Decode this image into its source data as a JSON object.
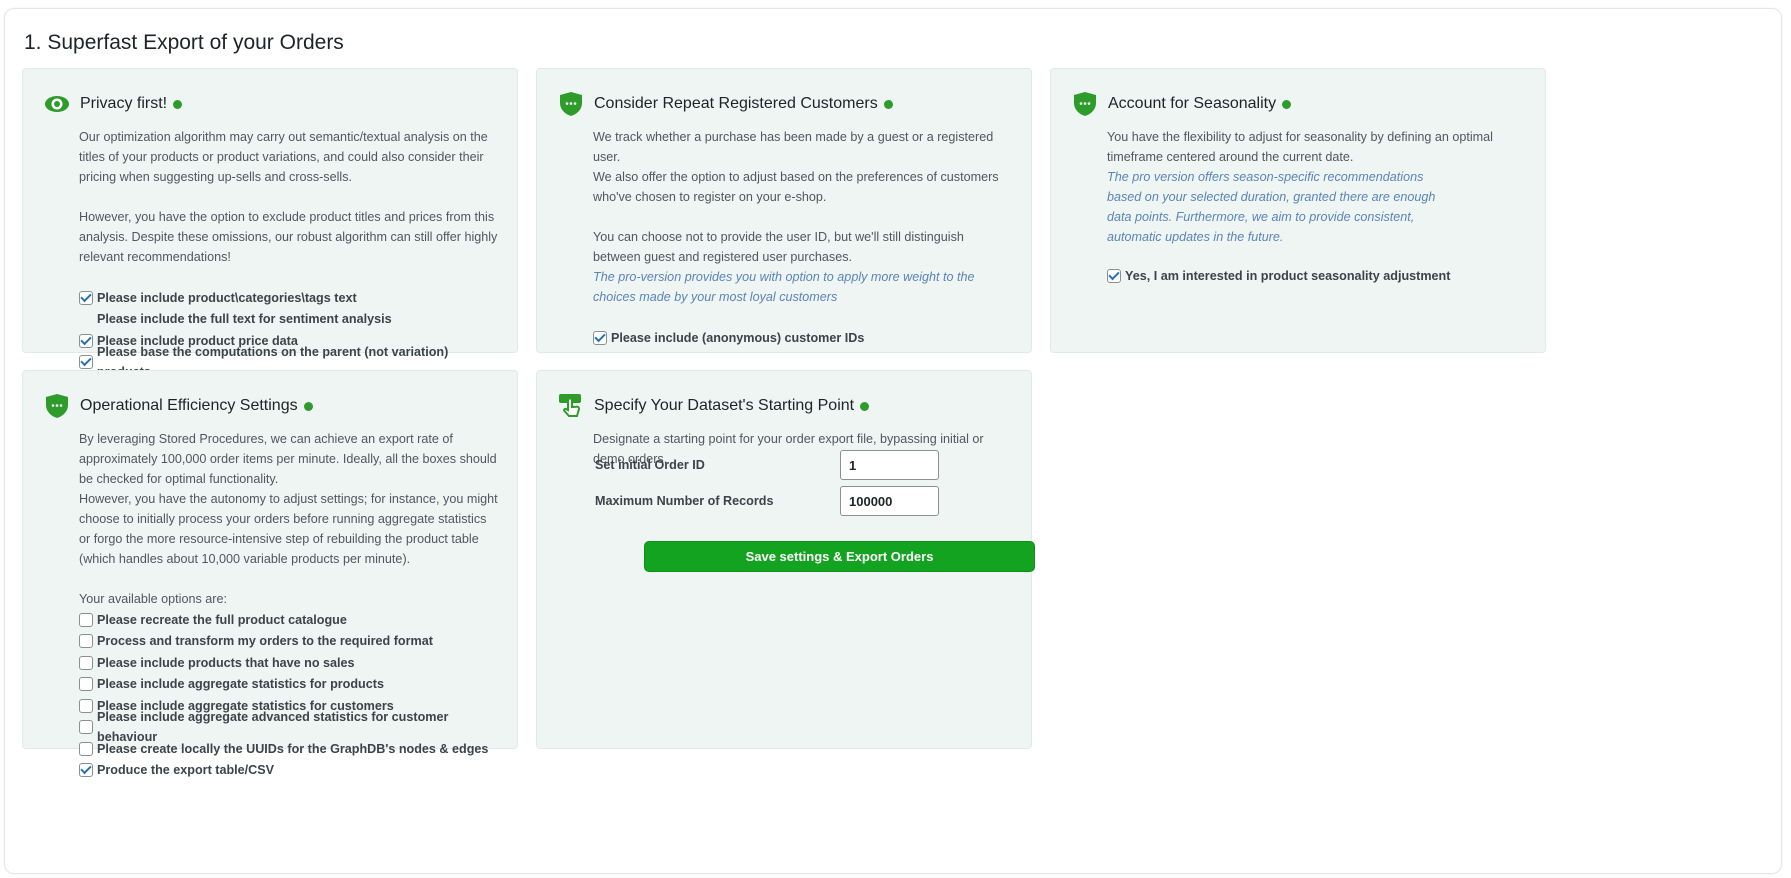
{
  "page": {
    "title": "1. Superfast Export of your Orders"
  },
  "colors": {
    "accent_green": "#2e9c2b",
    "card_bg": "#eef5f2",
    "button_bg": "#14a320",
    "pro_text": "#5b84b8"
  },
  "privacy": {
    "icon": "eye-icon",
    "title": "Privacy first!",
    "p1": "Our optimization algorithm may carry out semantic/textual analysis on the titles of your products or product variations, and could also consider their pricing when suggesting up-sells and cross-sells.",
    "p2": "However, you have the option to exclude product titles and prices from this analysis. Despite these omissions, our robust algorithm can still offer highly relevant recommendations!",
    "options": [
      {
        "label": "Please include product\\categories\\tags text",
        "checked": true
      },
      {
        "label": "Please include the full text for sentiment analysis",
        "checked": false
      },
      {
        "label": "Please include product price data",
        "checked": true
      },
      {
        "label": "Please base the computations on the parent (not variation) products",
        "checked": true
      }
    ]
  },
  "customers": {
    "icon": "shield-icon",
    "title": "Consider Repeat Registered Customers",
    "p1a": "We track whether a purchase has been made by a guest or a registered user.",
    "p1b": "We also offer the option to adjust based on the preferences of customers who've chosen to register on your e-shop.",
    "p2": "You can choose not to provide the user ID, but we'll still distinguish between guest and registered user purchases.",
    "pro": "The pro-version provides you with option to apply more weight to the choices made by your most loyal customers",
    "options": [
      {
        "label": "Please include (anonymous) customer IDs",
        "checked": true
      }
    ]
  },
  "seasonality": {
    "icon": "shield-icon",
    "title": "Account for Seasonality",
    "p1": "You have the flexibility to adjust for seasonality by defining an optimal timeframe centered around the current date.",
    "pro": "The pro version offers season-specific recommendations based on your selected duration, granted there are enough data points. Furthermore, we aim to provide consistent, automatic updates in the future.",
    "options": [
      {
        "label": "Yes, I am interested in product seasonality adjustment",
        "checked": true
      }
    ]
  },
  "efficiency": {
    "icon": "shield-icon",
    "title": "Operational Efficiency Settings",
    "p1": "By leveraging Stored Procedures, we can achieve an export rate of approximately 100,000 order items per minute. Ideally, all the boxes should be checked for optimal functionality.",
    "p2": "However, you have the autonomy to adjust settings; for instance, you might choose to initially process your orders before running aggregate statistics or forgo the more resource-intensive step of rebuilding the product table (which handles about 10,000 variable products per minute).",
    "options_intro": "Your available options are:",
    "options": [
      {
        "label": "Please recreate the full product catalogue",
        "checked": false
      },
      {
        "label": "Process and transform my orders to the required format",
        "checked": false
      },
      {
        "label": "Please include products that have no sales",
        "checked": false
      },
      {
        "label": "Please include aggregate statistics for products",
        "checked": false
      },
      {
        "label": "Please include aggregate statistics for customers",
        "checked": false
      },
      {
        "label": "Please include aggregate advanced statistics for customer behaviour",
        "checked": false
      },
      {
        "label": "Please create locally the UUIDs for the GraphDB's nodes & edges",
        "checked": false
      },
      {
        "label": "Produce the export table/CSV",
        "checked": true
      }
    ]
  },
  "dataset": {
    "icon": "tap-icon",
    "title": "Specify Your Dataset's Starting Point",
    "p1": "Designate a starting point for your order export file, bypassing initial or demo orders.",
    "initial_label": "Set initial Order ID",
    "initial_value": "1",
    "max_label": "Maximum Number of Records",
    "max_value": "100000",
    "button": "Save settings & Export Orders"
  }
}
